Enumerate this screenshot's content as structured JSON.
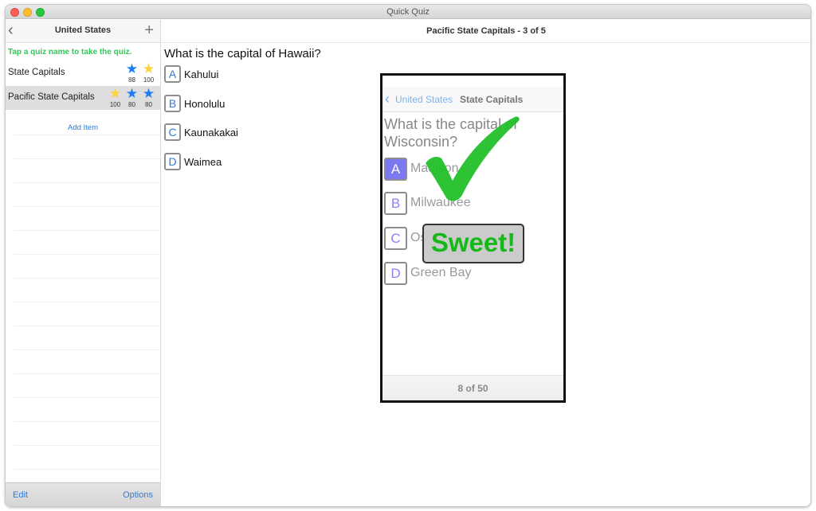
{
  "window": {
    "title": "Quick Quiz"
  },
  "sidebar": {
    "back_icon": "chevron-left-icon",
    "title": "United States",
    "add_icon": "plus-icon",
    "hint": "Tap a quiz name to take the quiz.",
    "quizzes": [
      {
        "name": "State Capitals",
        "selected": false,
        "stars": [
          {
            "color": "blue",
            "score": "88"
          },
          {
            "color": "gold",
            "score": "100"
          }
        ]
      },
      {
        "name": "Pacific State Capitals",
        "selected": true,
        "stars": [
          {
            "color": "gold",
            "score": "100"
          },
          {
            "color": "blue",
            "score": "80"
          },
          {
            "color": "blue",
            "score": "80"
          }
        ]
      }
    ],
    "add_item_label": "Add Item",
    "footer": {
      "edit_label": "Edit",
      "options_label": "Options"
    }
  },
  "main": {
    "title": "Pacific State Capitals - 3 of 5",
    "question": "What is the capital of Hawaii?",
    "answers": [
      {
        "letter": "A",
        "text": "Kahului"
      },
      {
        "letter": "B",
        "text": "Honolulu"
      },
      {
        "letter": "C",
        "text": "Kaunakakai"
      },
      {
        "letter": "D",
        "text": "Waimea"
      }
    ]
  },
  "phone_preview": {
    "nav_back_label": "United States",
    "nav_title": "State Capitals",
    "question": "What is the capital of Wisconsin?",
    "answers": [
      {
        "letter": "A",
        "text": "Madison",
        "selected": true
      },
      {
        "letter": "B",
        "text": "Milwaukee",
        "selected": false
      },
      {
        "letter": "C",
        "text": "Oshkosh",
        "selected": false
      },
      {
        "letter": "D",
        "text": "Green Bay",
        "selected": false
      }
    ],
    "feedback_label": "Sweet!",
    "progress_label": "8 of 50",
    "colors": {
      "check": "#22c02a",
      "selected_box": "#7b78f0"
    }
  }
}
